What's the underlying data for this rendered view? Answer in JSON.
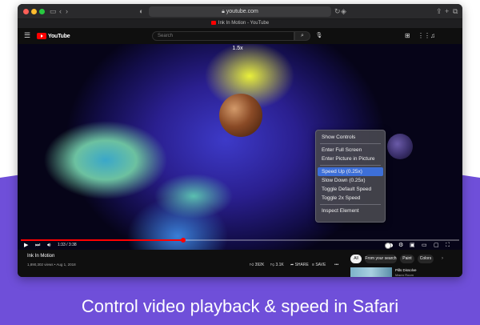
{
  "browser": {
    "url": "youtube.com",
    "tab_title": "Ink In Motion - YouTube"
  },
  "youtube": {
    "logo": "YouTube",
    "search_placeholder": "Search"
  },
  "video": {
    "speed_badge": "1.5x",
    "time": "1:33 / 3:38",
    "progress_fraction": 0.37,
    "title": "Ink In Motion",
    "meta": "1,890,302 views • Aug 1, 2018"
  },
  "context_menu": {
    "items": [
      {
        "label": "Show Controls"
      },
      {
        "label": "Enter Full Screen"
      },
      {
        "label": "Enter Picture in Picture"
      },
      {
        "label": "Speed Up (0.25x)",
        "active": true
      },
      {
        "label": "Slow Down (0.25x)"
      },
      {
        "label": "Toggle Default Speed"
      },
      {
        "label": "Toggle 2x Speed"
      },
      {
        "label": "Inspect Element"
      }
    ]
  },
  "actions": {
    "likes": "392K",
    "dislikes": "3.1K",
    "share": "SHARE",
    "save": "SAVE",
    "more": "•••"
  },
  "chips": [
    "All",
    "From your search",
    "Paint",
    "Colors"
  ],
  "recommendation": {
    "title": "Pills Dissolve",
    "channel": "Macro Room"
  },
  "caption": "Control video playback & speed in Safari",
  "colors": {
    "promo_purple": "#6f4fd9",
    "youtube_red": "#ff0000",
    "menu_highlight": "#3d6fd8"
  }
}
